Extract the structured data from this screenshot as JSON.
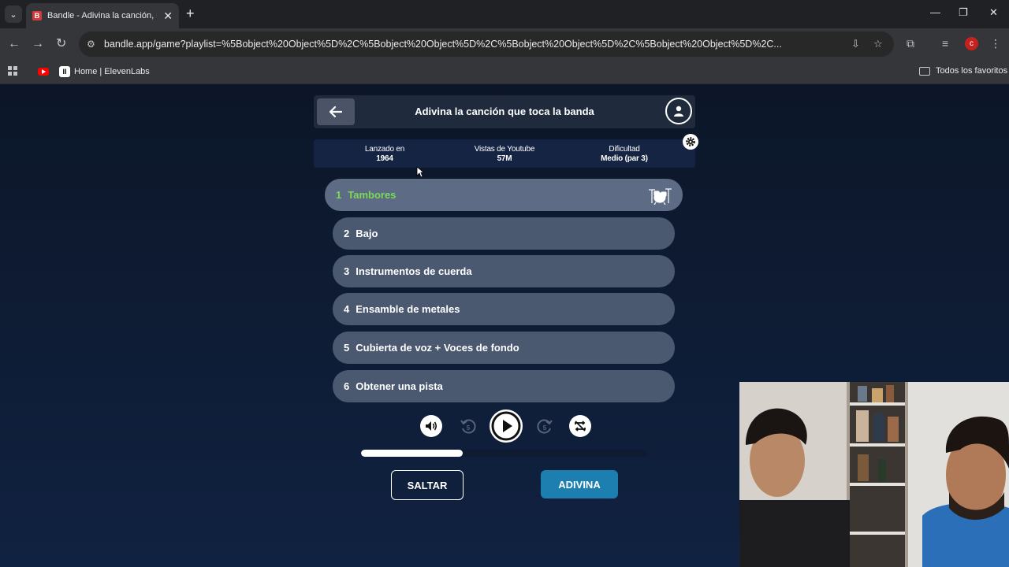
{
  "browser": {
    "tab_title": "Bandle - Adivina la canción, un",
    "url": "bandle.app/game?playlist=%5Bobject%20Object%5D%2C%5Bobject%20Object%5D%2C%5Bobject%20Object%5D%2C%5Bobject%20Object%5D%2C...",
    "bookmarks": [
      {
        "label": "Home | ElevenLabs"
      }
    ],
    "all_bookmarks_label": "Todos los favoritos",
    "profile_initial": "c",
    "favicon_letter": "B",
    "elevenlabs_letter": "II"
  },
  "game": {
    "title": "Adivina la canción que toca la banda",
    "info": [
      {
        "label": "Lanzado en",
        "value": "1964"
      },
      {
        "label": "Vistas de Youtube",
        "value": "57M"
      },
      {
        "label": "Dificultad",
        "value": "Medio (par 3)"
      }
    ],
    "tracks": [
      {
        "num": "1",
        "label": "Tambores",
        "active": true
      },
      {
        "num": "2",
        "label": "Bajo",
        "active": false
      },
      {
        "num": "3",
        "label": "Instrumentos de cuerda",
        "active": false
      },
      {
        "num": "4",
        "label": "Ensamble de metales",
        "active": false
      },
      {
        "num": "5",
        "label": "Cubierta de voz + Voces de fondo",
        "active": false
      },
      {
        "num": "6",
        "label": "Obtener una pista",
        "active": false
      }
    ],
    "controls": {
      "rewind_seconds": "5",
      "forward_seconds": "5"
    },
    "progress": 0.355,
    "skip_label": "SALTAR",
    "guess_label": "ADIVINA",
    "colors": {
      "active_track_text": "#7cd957",
      "guess_button": "#1c7fb0",
      "track_bg": "#4a5870"
    }
  }
}
